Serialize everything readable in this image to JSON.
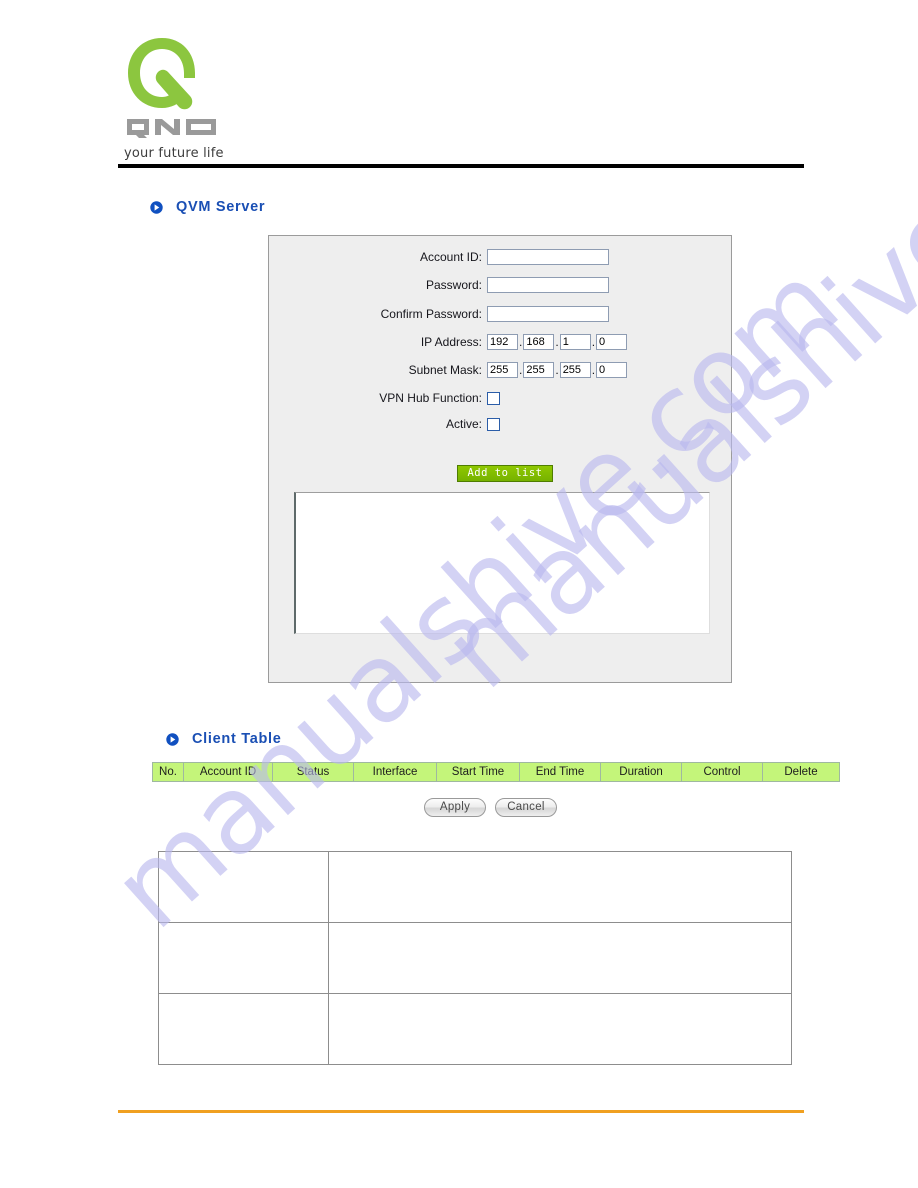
{
  "brand": {
    "wordmark": "QNO",
    "tagline": "your future life",
    "logo_green": "#8cc63f",
    "wordmark_gray": "#9a9a9a"
  },
  "watermark": {
    "text": "manualshive.com",
    "color": "#b9b8ee"
  },
  "sections": {
    "qvm_server": {
      "title": "QVM Server",
      "icon": "blue-play-bullet-icon"
    },
    "client_table": {
      "title": "Client Table",
      "icon": "blue-play-bullet-icon"
    }
  },
  "form": {
    "account_id": {
      "label": "Account ID:",
      "value": "",
      "placeholder": ""
    },
    "password": {
      "label": "Password:",
      "value": "",
      "placeholder": ""
    },
    "confirm_password": {
      "label": "Confirm Password:",
      "value": "",
      "placeholder": ""
    },
    "ip_address": {
      "label": "IP Address:",
      "octets": [
        "192",
        "168",
        "1",
        "0"
      ],
      "separator": "."
    },
    "subnet_mask": {
      "label": "Subnet Mask:",
      "octets": [
        "255",
        "255",
        "255",
        "0"
      ],
      "separator": "."
    },
    "vpn_hub_function": {
      "label": "VPN Hub Function:",
      "checked": false
    },
    "active": {
      "label": "Active:",
      "checked": false
    },
    "add_to_list_button": "Add to list",
    "list_box_items": []
  },
  "client_table": {
    "columns": [
      "No.",
      "Account ID",
      "Status",
      "Interface",
      "Start Time",
      "End Time",
      "Duration",
      "Control",
      "Delete"
    ],
    "rows": [],
    "header_bg": "#c4f57a"
  },
  "actions": {
    "apply": "Apply",
    "cancel": "Cancel"
  },
  "description_table": {
    "rows": [
      {
        "term": "",
        "definition": ""
      },
      {
        "term": "",
        "definition": ""
      },
      {
        "term": "",
        "definition": ""
      }
    ]
  },
  "rules": {
    "header_color": "#000000",
    "footer_color": "#f0a020"
  }
}
